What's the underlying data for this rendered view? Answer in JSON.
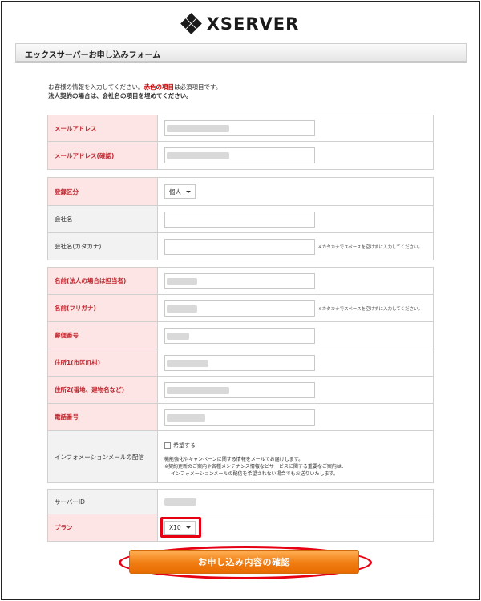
{
  "brand": {
    "name": "XSERVER"
  },
  "form_title": "エックスサーバーお申し込みフォーム",
  "intro": {
    "line1_a": "お客様の情報を入力してください。",
    "line1_red": "赤色の項目",
    "line1_b": "は必須項目です。",
    "line2": "法人契約の場合は、会社名の項目を埋めてください。"
  },
  "notes": {
    "katakana": "※カタカナでスペースを空けずに入力してください。"
  },
  "group1": {
    "email": "メールアドレス",
    "email_confirm": "メールアドレス(確認)"
  },
  "group2": {
    "reg_type": "登録区分",
    "reg_type_value": "個人",
    "company": "会社名",
    "company_kana": "会社名(カタカナ)"
  },
  "group3": {
    "name": "名前(法人の場合は担当者)",
    "name_kana": "名前(フリガナ)",
    "postal": "郵便番号",
    "address1": "住所1(市区町村)",
    "address2": "住所2(番地、建物名など)",
    "phone": "電話番号",
    "info_mail": "インフォメーションメールの配信",
    "info_checkbox": "希望する",
    "info_text1": "機能強化やキャンペーンに関する情報をメールでお届けします。",
    "info_text2": "※契約更新のご案内や各種メンテナンス情報などサービスに関する重要なご案内は、",
    "info_text3": "インフォメーションメールの配信を希望されない場合でもお送りいたします。"
  },
  "group4": {
    "server_id": "サーバーID",
    "plan": "プラン",
    "plan_value": "X10"
  },
  "submit_label": "お申し込み内容の確認"
}
